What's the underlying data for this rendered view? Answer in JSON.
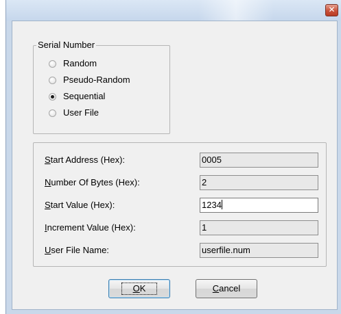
{
  "window": {
    "close_glyph": "✕",
    "accent_color": "#c9d8ea"
  },
  "serial_group": {
    "legend": "Serial Number",
    "options": [
      {
        "label": "Random",
        "checked": false
      },
      {
        "label": "Pseudo-Random",
        "checked": false
      },
      {
        "label": "Sequential",
        "checked": true
      },
      {
        "label": "User File",
        "checked": false
      }
    ]
  },
  "fields": [
    {
      "ak": "S",
      "rest": "tart Address (Hex):",
      "value": "0005"
    },
    {
      "ak": "N",
      "rest": "umber Of Bytes (Hex):",
      "value": "2"
    },
    {
      "ak": "S",
      "rest": "tart Value (Hex):",
      "value": "1234"
    },
    {
      "ak": "I",
      "rest": "ncrement Value (Hex):",
      "value": "1"
    },
    {
      "ak": "U",
      "rest": "ser File Name:",
      "value": "userfile.num"
    }
  ],
  "buttons": {
    "ok": {
      "ak": "O",
      "rest": "K"
    },
    "cancel": {
      "ak": "C",
      "rest": "ancel"
    }
  }
}
